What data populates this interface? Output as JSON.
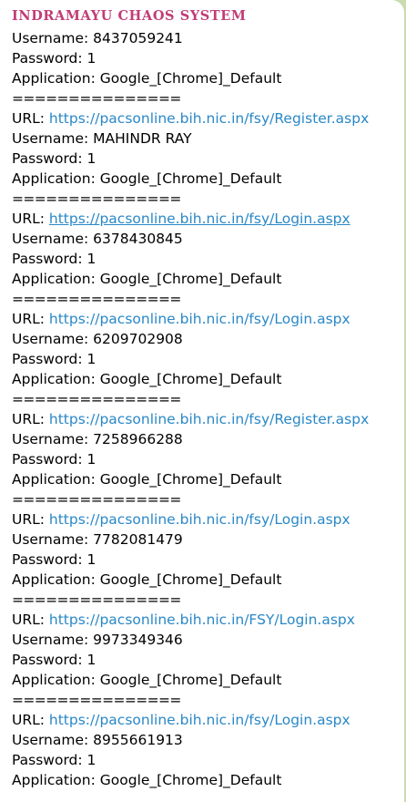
{
  "message": {
    "sender": "INDRAMAYU CHAOS SYSTEM",
    "link_color": "#2a88c7",
    "sender_color": "#c13d77",
    "first_entry": {
      "username": "Username: 8437059241",
      "password": "Password: 1",
      "application": "Application: Google_[Chrome]_Default",
      "separator": "==============="
    },
    "entries": [
      {
        "url_label": "URL: ",
        "url": "https://pacsonline.bih.nic.in/fsy/Register.aspx",
        "username": "Username: MAHINDR RAY",
        "password": "Password: 1",
        "application": "Application: Google_[Chrome]_Default",
        "separator": "==============="
      },
      {
        "url_label": "URL: ",
        "url": "https://pacsonline.bih.nic.in/fsy/Login.aspx",
        "username": "Username: 6378430845",
        "password": "Password: 1",
        "application": "Application: Google_[Chrome]_Default",
        "separator": "==============="
      },
      {
        "url_label": "URL: ",
        "url": "https://pacsonline.bih.nic.in/fsy/Login.aspx",
        "username": "Username: 6209702908",
        "password": "Password: 1",
        "application": "Application: Google_[Chrome]_Default",
        "separator": "==============="
      },
      {
        "url_label": "URL: ",
        "url": "https://pacsonline.bih.nic.in/fsy/Register.aspx",
        "username": "Username: 7258966288",
        "password": "Password: 1",
        "application": "Application: Google_[Chrome]_Default",
        "separator": "==============="
      },
      {
        "url_label": "URL: ",
        "url": "https://pacsonline.bih.nic.in/fsy/Login.aspx",
        "username": "Username: 7782081479",
        "password": "Password: 1",
        "application": "Application: Google_[Chrome]_Default",
        "separator": "==============="
      },
      {
        "url_label": "URL: ",
        "url": "https://pacsonline.bih.nic.in/FSY/Login.aspx",
        "username": "Username: 9973349346",
        "password": "Password: 1",
        "application": "Application: Google_[Chrome]_Default",
        "separator": "==============="
      },
      {
        "url_label": "URL: ",
        "url": "https://pacsonline.bih.nic.in/fsy/Login.aspx",
        "username": "Username: 8955661913",
        "password": "Password: 1",
        "application": "Application: Google_[Chrome]_Default"
      }
    ]
  }
}
